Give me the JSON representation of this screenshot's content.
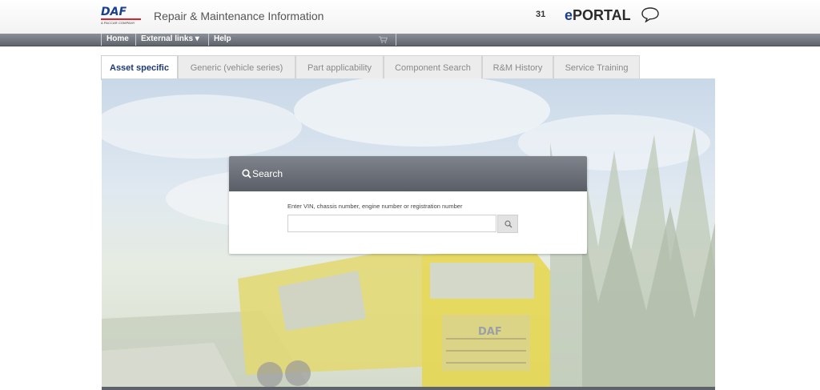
{
  "header": {
    "logo_text": "DAF",
    "logo_subtext": "A PACCAR COMPANY",
    "app_title": "Repair & Maintenance Information",
    "counter": "31",
    "eportal_e": "e",
    "eportal_rest": "PORTAL"
  },
  "nav": {
    "items": [
      {
        "label": "Home"
      },
      {
        "label": "External links ▾"
      },
      {
        "label": "Help"
      }
    ]
  },
  "tabs": [
    {
      "label": "Asset specific",
      "active": true
    },
    {
      "label": "Generic (vehicle series)",
      "active": false
    },
    {
      "label": "Part applicability",
      "active": false
    },
    {
      "label": "Component Search",
      "active": false
    },
    {
      "label": "R&M History",
      "active": false
    },
    {
      "label": "Service Training",
      "active": false
    }
  ],
  "search": {
    "title": "Search",
    "field_label": "Enter VIN, chassis number, engine number or registration number",
    "value": "",
    "placeholder": ""
  },
  "hero": {
    "truck_brand": "DAF"
  },
  "colors": {
    "brand_blue": "#1a3f8f",
    "brand_red": "#d8232a",
    "nav_gray": "#6f747c",
    "truck_yellow": "#e6d64a"
  }
}
